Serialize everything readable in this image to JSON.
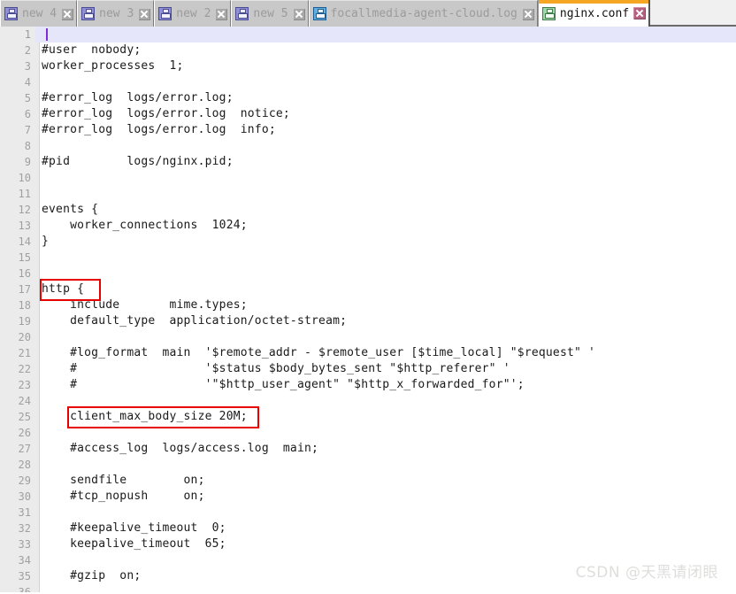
{
  "window": {
    "app_kind": "text-editor",
    "colors": {
      "active_tab_accent": "#f5a623",
      "tabbar_bg": "#f0f0f0",
      "inactive_tab_bg": "#c8c8c8",
      "gutter_bg": "#ebebeb",
      "current_line_bg": "#e6e6fa",
      "caret": "#7b2fd6",
      "annotation_red": "#e60000",
      "code_text": "#1a1a1a",
      "line_number_text": "#a0a0a0"
    }
  },
  "tabbar": {
    "tabs": [
      {
        "label": "new  4",
        "icon": "floppy-disk-icon",
        "icon_color": "purple",
        "close_icon": "close-icon",
        "active": false
      },
      {
        "label": "new  3",
        "icon": "floppy-disk-icon",
        "icon_color": "purple",
        "close_icon": "close-icon",
        "active": false
      },
      {
        "label": "new  2",
        "icon": "floppy-disk-icon",
        "icon_color": "purple",
        "close_icon": "close-icon",
        "active": false
      },
      {
        "label": "new  5",
        "icon": "floppy-disk-icon",
        "icon_color": "purple",
        "close_icon": "close-icon",
        "active": false
      },
      {
        "label": "focallmedia-agent-cloud.log",
        "icon": "floppy-disk-icon",
        "icon_color": "blue",
        "close_icon": "close-icon",
        "active": false
      },
      {
        "label": "nginx.conf",
        "icon": "floppy-disk-icon",
        "icon_color": "green",
        "close_icon": "close-icon",
        "active": true
      }
    ]
  },
  "editor": {
    "current_line": 1,
    "first_visible_line": 1,
    "last_visible_line": 36,
    "lines": [
      {
        "n": "1",
        "text": ""
      },
      {
        "n": "2",
        "text": "#user  nobody;"
      },
      {
        "n": "3",
        "text": "worker_processes  1;"
      },
      {
        "n": "4",
        "text": ""
      },
      {
        "n": "5",
        "text": "#error_log  logs/error.log;"
      },
      {
        "n": "6",
        "text": "#error_log  logs/error.log  notice;"
      },
      {
        "n": "7",
        "text": "#error_log  logs/error.log  info;"
      },
      {
        "n": "8",
        "text": ""
      },
      {
        "n": "9",
        "text": "#pid        logs/nginx.pid;"
      },
      {
        "n": "10",
        "text": ""
      },
      {
        "n": "11",
        "text": ""
      },
      {
        "n": "12",
        "text": "events {"
      },
      {
        "n": "13",
        "text": "    worker_connections  1024;"
      },
      {
        "n": "14",
        "text": "}"
      },
      {
        "n": "15",
        "text": ""
      },
      {
        "n": "16",
        "text": ""
      },
      {
        "n": "17",
        "text": "http {"
      },
      {
        "n": "18",
        "text": "    include       mime.types;"
      },
      {
        "n": "19",
        "text": "    default_type  application/octet-stream;"
      },
      {
        "n": "20",
        "text": ""
      },
      {
        "n": "21",
        "text": "    #log_format  main  '$remote_addr - $remote_user [$time_local] \"$request\" '"
      },
      {
        "n": "22",
        "text": "    #                  '$status $body_bytes_sent \"$http_referer\" '"
      },
      {
        "n": "23",
        "text": "    #                  '\"$http_user_agent\" \"$http_x_forwarded_for\"';"
      },
      {
        "n": "24",
        "text": ""
      },
      {
        "n": "25",
        "text": "    client_max_body_size 20M;"
      },
      {
        "n": "26",
        "text": ""
      },
      {
        "n": "27",
        "text": "    #access_log  logs/access.log  main;"
      },
      {
        "n": "28",
        "text": ""
      },
      {
        "n": "29",
        "text": "    sendfile        on;"
      },
      {
        "n": "30",
        "text": "    #tcp_nopush     on;"
      },
      {
        "n": "31",
        "text": ""
      },
      {
        "n": "32",
        "text": "    #keepalive_timeout  0;"
      },
      {
        "n": "33",
        "text": "    keepalive_timeout  65;"
      },
      {
        "n": "34",
        "text": ""
      },
      {
        "n": "35",
        "text": "    #gzip  on;"
      },
      {
        "n": "36",
        "text": ""
      }
    ]
  },
  "annotations": [
    {
      "name": "http-block-highlight",
      "target_line": "17",
      "label": "http {"
    },
    {
      "name": "client-max-body-size-highlight",
      "target_line": "25",
      "label": "client_max_body_size 20M;"
    }
  ],
  "watermark": {
    "text": "CSDN @天黑请闭眼"
  }
}
